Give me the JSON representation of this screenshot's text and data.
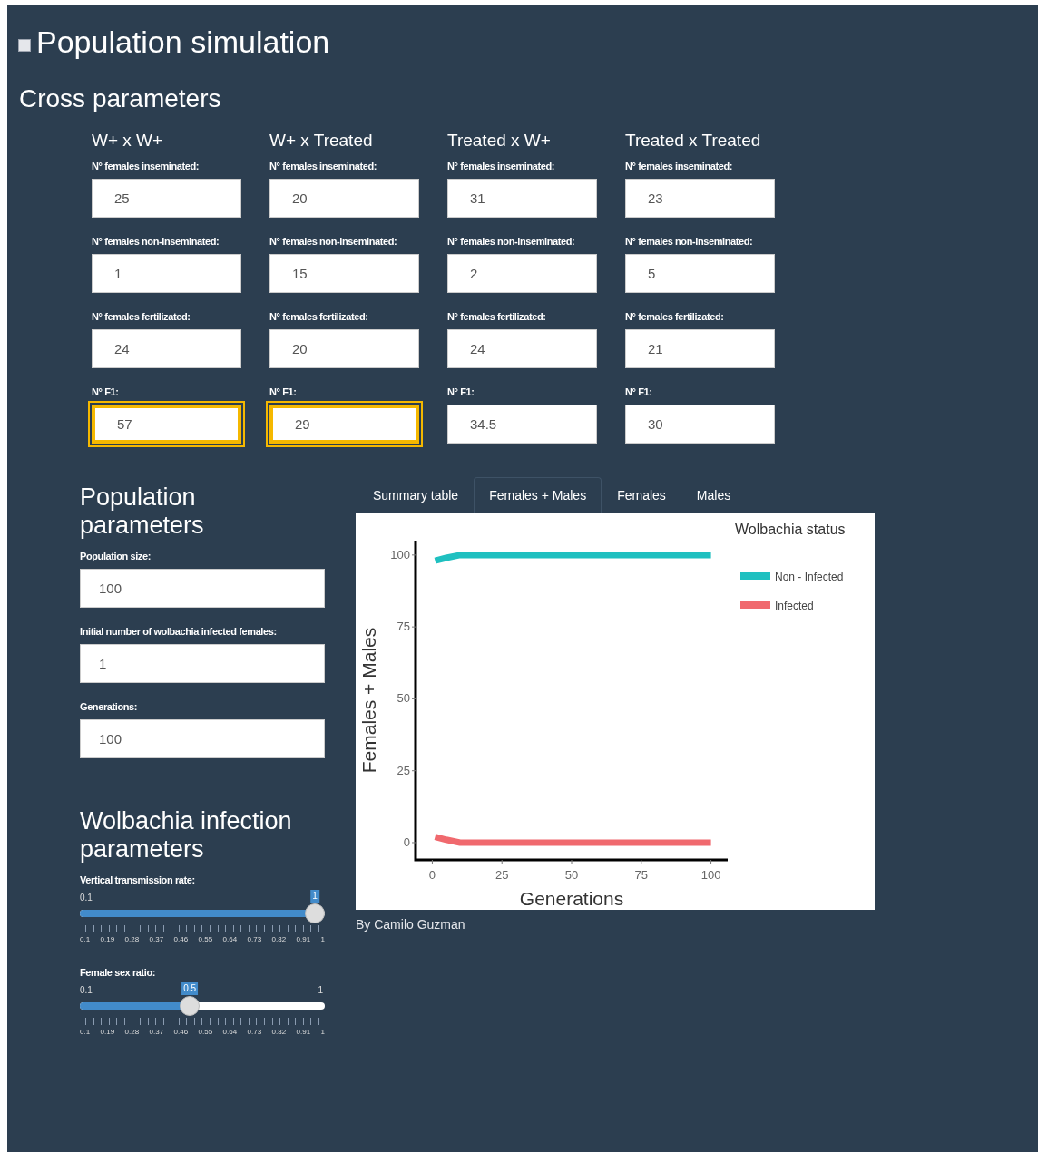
{
  "title": "Population simulation",
  "cross_parameters": {
    "heading": "Cross parameters",
    "columns": [
      {
        "heading": "W+ x W+",
        "fields": [
          {
            "label": "N° females inseminated:",
            "value": "25",
            "highlighted": false
          },
          {
            "label": "N° females non-inseminated:",
            "value": "1",
            "highlighted": false
          },
          {
            "label": "N° females fertilizated:",
            "value": "24",
            "highlighted": false
          },
          {
            "label": "N° F1:",
            "value": "57",
            "highlighted": true
          }
        ]
      },
      {
        "heading": "W+ x Treated",
        "fields": [
          {
            "label": "N° females inseminated:",
            "value": "20",
            "highlighted": false
          },
          {
            "label": "N° females non-inseminated:",
            "value": "15",
            "highlighted": false
          },
          {
            "label": "N° females fertilizated:",
            "value": "20",
            "highlighted": false
          },
          {
            "label": "N° F1:",
            "value": "29",
            "highlighted": true
          }
        ]
      },
      {
        "heading": "Treated x W+",
        "fields": [
          {
            "label": "N° females inseminated:",
            "value": "31",
            "highlighted": false
          },
          {
            "label": "N° females non-inseminated:",
            "value": "2",
            "highlighted": false
          },
          {
            "label": "N° females fertilizated:",
            "value": "24",
            "highlighted": false
          },
          {
            "label": "N° F1:",
            "value": "34.5",
            "highlighted": false
          }
        ]
      },
      {
        "heading": "Treated x Treated",
        "fields": [
          {
            "label": "N° females inseminated:",
            "value": "23",
            "highlighted": false
          },
          {
            "label": "N° females non-inseminated:",
            "value": "5",
            "highlighted": false
          },
          {
            "label": "N° females fertilizated:",
            "value": "21",
            "highlighted": false
          },
          {
            "label": "N° F1:",
            "value": "30",
            "highlighted": false
          }
        ]
      }
    ]
  },
  "population_parameters": {
    "heading": "Population parameters",
    "fields": [
      {
        "label": "Population size:",
        "value": "100"
      },
      {
        "label": "Initial number of wolbachia infected females:",
        "value": "1"
      },
      {
        "label": "Generations:",
        "value": "100"
      }
    ]
  },
  "infection_parameters": {
    "heading": "Wolbachia infection parameters",
    "sliders": [
      {
        "label": "Vertical transmission rate:",
        "min": "0.1",
        "value": "1",
        "level": 1,
        "ticks": [
          "0.1",
          "0.19",
          "0.28",
          "0.37",
          "0.46",
          "0.55",
          "0.64",
          "0.73",
          "0.82",
          "0.91",
          "1"
        ]
      },
      {
        "label": "Female sex ratio:",
        "min": "0.1",
        "max": "1",
        "value": "0.5",
        "level": 0.444,
        "ticks": [
          "0.1",
          "0.19",
          "0.28",
          "0.37",
          "0.46",
          "0.55",
          "0.64",
          "0.73",
          "0.82",
          "0.91",
          "1"
        ]
      }
    ]
  },
  "tabs": [
    {
      "label": "Summary table",
      "selected": false
    },
    {
      "label": "Females + Males",
      "selected": true
    },
    {
      "label": "Females",
      "selected": false
    },
    {
      "label": "Males",
      "selected": false
    }
  ],
  "chart": {
    "chart_data": {
      "type": "line",
      "xlabel": "Generations",
      "ylabel": "Females + Males",
      "legend": {
        "title": "Wolbachia status"
      },
      "x": [
        1,
        5,
        10,
        25,
        50,
        75,
        100
      ],
      "series": [
        {
          "name": "Non - Infected",
          "color": "#1fc0c0",
          "values": [
            98,
            99,
            100,
            100,
            100,
            100,
            100
          ]
        },
        {
          "name": "Infected",
          "color": "#f0696e",
          "values": [
            2,
            1,
            0,
            0,
            0,
            0,
            0
          ]
        }
      ],
      "xlim": [
        -6,
        106
      ],
      "ylim": [
        -6,
        105
      ],
      "xticks": [
        0,
        25,
        50,
        75,
        100
      ],
      "yticks": [
        0,
        25,
        50,
        75,
        100
      ]
    }
  },
  "footer": "By Camilo Guzman"
}
